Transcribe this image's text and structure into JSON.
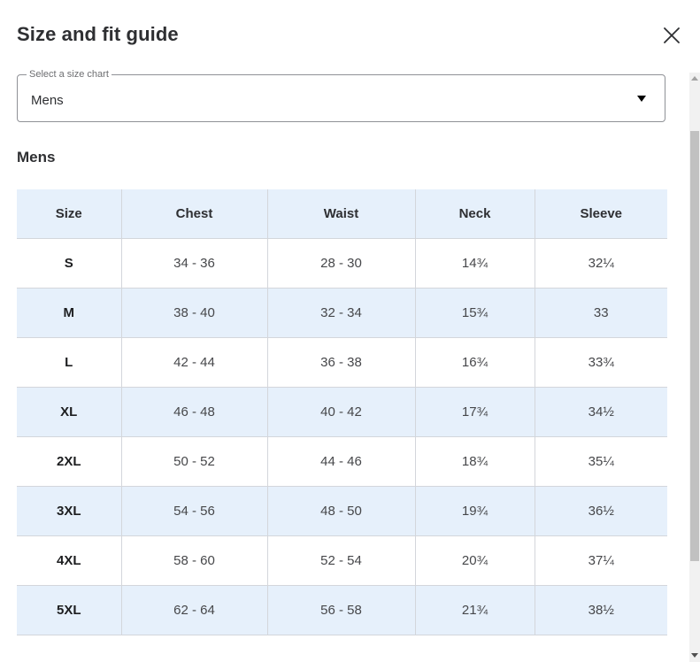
{
  "modal": {
    "title": "Size and fit guide",
    "close_icon": "close-icon"
  },
  "size_chart_select": {
    "legend": "Select a size chart",
    "value": "Mens",
    "arrow_icon": "caret-down-icon"
  },
  "section": {
    "heading": "Mens"
  },
  "table": {
    "headers": [
      "Size",
      "Chest",
      "Waist",
      "Neck",
      "Sleeve"
    ],
    "rows": [
      [
        "S",
        "34 - 36",
        "28 - 30",
        "14¾",
        "32¼"
      ],
      [
        "M",
        "38 - 40",
        "32 - 34",
        "15¾",
        "33"
      ],
      [
        "L",
        "42 - 44",
        "36 - 38",
        "16¾",
        "33¾"
      ],
      [
        "XL",
        "46 - 48",
        "40 - 42",
        "17¾",
        "34½"
      ],
      [
        "2XL",
        "50 - 52",
        "44 - 46",
        "18¾",
        "35¼"
      ],
      [
        "3XL",
        "54 - 56",
        "48 - 50",
        "19¾",
        "36½"
      ],
      [
        "4XL",
        "58 - 60",
        "52 - 54",
        "20¾",
        "37¼"
      ],
      [
        "5XL",
        "62 - 64",
        "56 - 58",
        "21¾",
        "38½"
      ]
    ]
  },
  "colors": {
    "header_bg": "#e6f0fb",
    "stripe_bg": "#e6f0fb",
    "border": "#d3d6db",
    "text": "#2e2f32"
  }
}
